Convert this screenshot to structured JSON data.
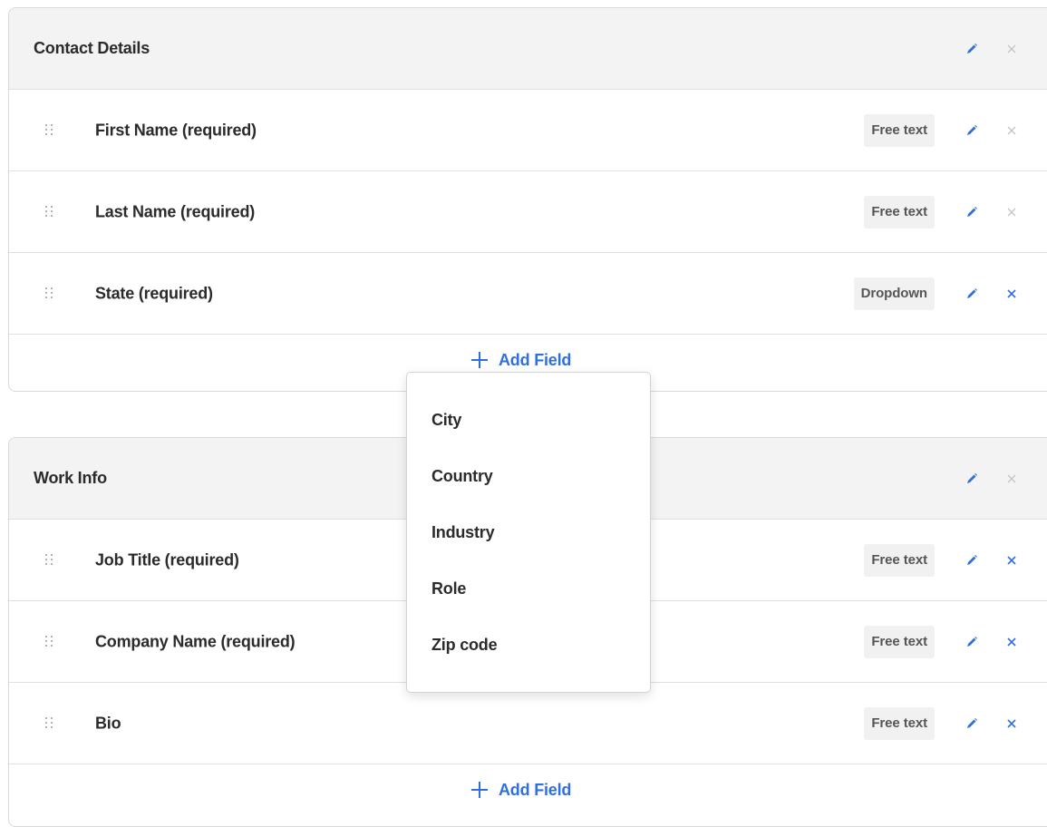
{
  "colors": {
    "accent": "#2f6fe0",
    "muted_icon": "#c4c4c4",
    "header_bg": "#f3f3f3",
    "badge_bg": "#f1f1f1"
  },
  "sections": [
    {
      "title": "Contact Details",
      "header_edit_icon": "pencil-icon",
      "header_remove_icon": "close-icon",
      "header_remove_enabled": false,
      "fields": [
        {
          "label": "First Name (required)",
          "type": "Free text",
          "remove_enabled": false
        },
        {
          "label": "Last Name (required)",
          "type": "Free text",
          "remove_enabled": false
        },
        {
          "label": "State (required)",
          "type": "Dropdown",
          "remove_enabled": true
        }
      ],
      "add_field_label": "Add Field"
    },
    {
      "title": "Work Info",
      "header_edit_icon": "pencil-icon",
      "header_remove_icon": "close-icon",
      "header_remove_enabled": false,
      "fields": [
        {
          "label": "Job Title (required)",
          "type": "Free text",
          "remove_enabled": true
        },
        {
          "label": "Company Name (required)",
          "type": "Free text",
          "remove_enabled": true
        },
        {
          "label": "Bio",
          "type": "Free text",
          "remove_enabled": true
        }
      ],
      "add_field_label": "Add Field"
    }
  ],
  "add_field_dropdown": {
    "options": [
      "City",
      "Country",
      "Industry",
      "Role",
      "Zip code"
    ]
  }
}
